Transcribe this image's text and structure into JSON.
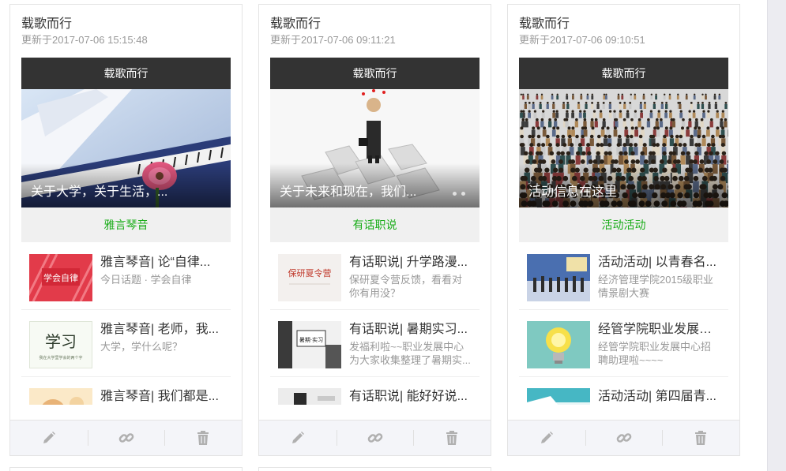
{
  "cards": [
    {
      "title": "载歌而行",
      "updated": "更新于2017-07-06 15:15:48",
      "bar_title": "载歌而行",
      "hero_caption": "关于大学，关于生活，...",
      "account": "雅言琴音",
      "items": [
        {
          "title": "雅言琴音| 论“自律...",
          "desc": "今日话题 · 学会自律",
          "thumb_text": "学会自律"
        },
        {
          "title": "雅言琴音| 老师，我...",
          "desc": "大学，学什么呢？",
          "thumb_text": "学习",
          "thumb_sub": "我在大学里学会的两个字"
        },
        {
          "title": "雅言琴音| 我们都是...",
          "desc": ""
        }
      ]
    },
    {
      "title": "载歌而行",
      "updated": "更新于2017-07-06 09:11:21",
      "bar_title": "载歌而行",
      "hero_caption": "关于未来和现在，我们...",
      "account": "有话职说",
      "items": [
        {
          "title": "有话职说| 升学路漫...",
          "desc": "保研夏令营反馈，看看对你有用没？",
          "thumb_text": "保研夏令营"
        },
        {
          "title": "有话职说| 暑期实习...",
          "desc": "发福利啦~~职业发展中心为大家收集整理了暑期实...",
          "thumb_text": "暑期·实习"
        },
        {
          "title": "有话职说| 能好好说...",
          "desc": ""
        }
      ]
    },
    {
      "title": "载歌而行",
      "updated": "更新于2017-07-06 09:10:51",
      "bar_title": "载歌而行",
      "hero_caption": "活动信息在这里",
      "account": "活动活动",
      "items": [
        {
          "title": "活动活动| 以青春名...",
          "desc": "经济管理学院2015级职业情景剧大赛"
        },
        {
          "title": "经管学院职业发展中...",
          "desc": "经管学院职业发展中心招聘助理啦~~~~"
        },
        {
          "title": "活动活动| 第四届青...",
          "desc": ""
        }
      ]
    }
  ],
  "actions": {
    "edit_icon": "pencil-icon",
    "link_icon": "link-icon",
    "delete_icon": "trash-icon"
  },
  "colors": {
    "accent_green": "#1aad19",
    "bar_dark": "#333333",
    "icon_grey": "#b0b0b0"
  }
}
